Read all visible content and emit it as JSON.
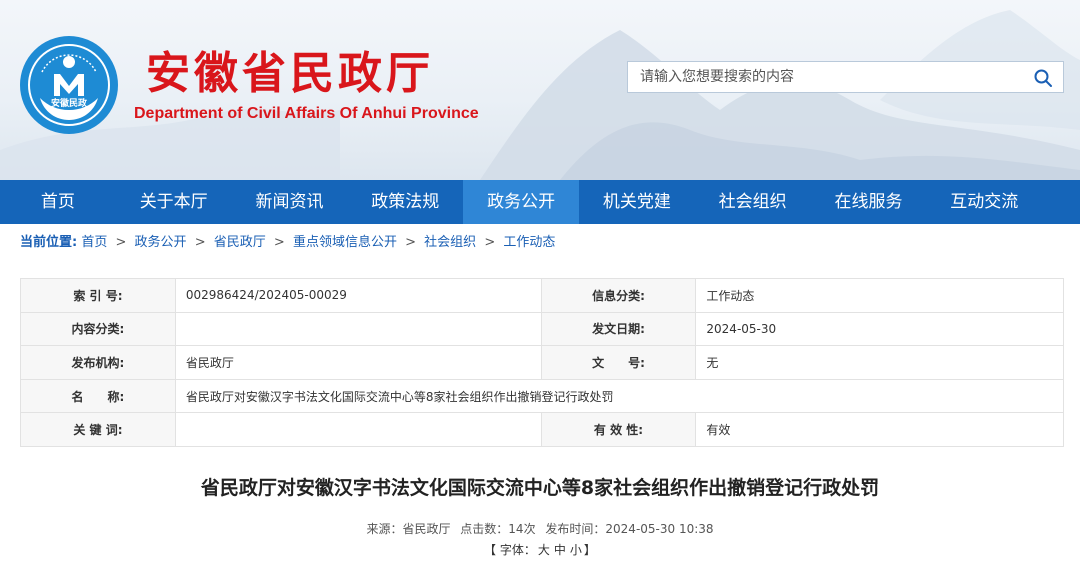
{
  "site": {
    "title_cn": "安徽省民政厅",
    "title_en": "Department of Civil Affairs Of Anhui Province",
    "logo_text": "安徽民政",
    "brand_color": "#d9161b",
    "nav_color": "#1565b9"
  },
  "search": {
    "placeholder": "请输入您想要搜索的内容",
    "icon": "search-icon"
  },
  "nav": {
    "items": [
      "首页",
      "关于本厅",
      "新闻资讯",
      "政策法规",
      "政务公开",
      "机关党建",
      "社会组织",
      "在线服务",
      "互动交流"
    ],
    "active": "政务公开"
  },
  "breadcrumb": {
    "label": "当前位置:",
    "items": [
      "首页",
      "政务公开",
      "省民政厅",
      "重点领域信息公开",
      "社会组织",
      "工作动态"
    ],
    "separator": ">"
  },
  "meta_table": {
    "index_label": "索 引 号:",
    "index_value": "002986424/202405-00029",
    "category_label": "信息分类:",
    "category_value": "工作动态",
    "content_type_label": "内容分类:",
    "content_type_value": "",
    "date_label": "发文日期:",
    "date_value": "2024-05-30",
    "publisher_label": "发布机构:",
    "publisher_value": "省民政厅",
    "doc_no_label": "文　　号:",
    "doc_no_value": "无",
    "name_label": "名　　称:",
    "name_value": "省民政厅对安徽汉字书法文化国际交流中心等8家社会组织作出撤销登记行政处罚",
    "keywords_label": "关 键 词:",
    "keywords_value": "",
    "validity_label": "有 效 性:",
    "validity_value": "有效"
  },
  "article": {
    "title": "省民政厅对安徽汉字书法文化国际交流中心等8家社会组织作出撤销登记行政处罚",
    "source": "来源：省民政厅",
    "clicks": "点击数：14次",
    "published": "发布时间：2024-05-30 10:38",
    "font_label": "【 字体：",
    "font_large": "大",
    "font_medium": "中",
    "font_small": "小",
    "font_close": "】"
  }
}
